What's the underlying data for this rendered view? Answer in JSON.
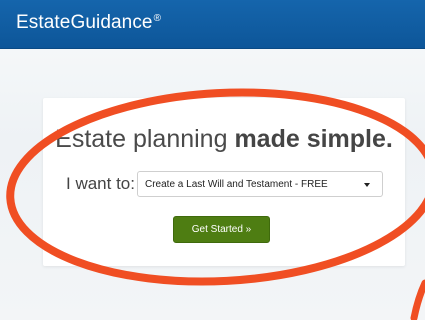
{
  "header": {
    "brand_name": "EstateGuidance",
    "brand_mark": "®",
    "background_color": "#1565ac"
  },
  "hero": {
    "headline_regular": "Estate planning ",
    "headline_bold": "made simple."
  },
  "form": {
    "want_label": "I want to:",
    "selected_option": "Create a Last Will and Testament - FREE",
    "submit_label": "Get Started »",
    "submit_color": "#4e7d12"
  },
  "annotation": {
    "circle_color": "#f04e23"
  }
}
